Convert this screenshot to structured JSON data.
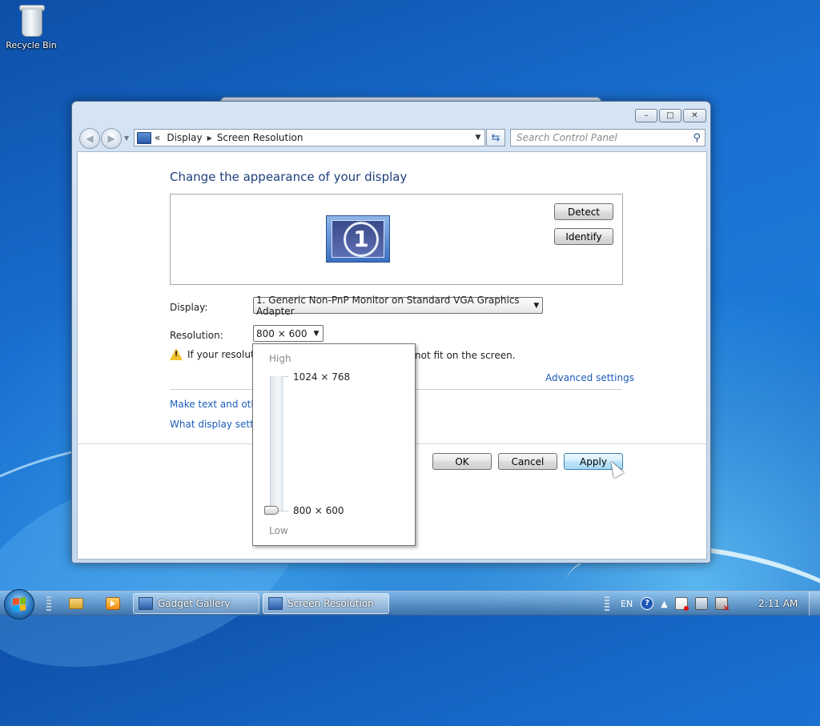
{
  "desktop": {
    "recycle_bin_label": "Recycle Bin"
  },
  "window": {
    "title_controls": {
      "minimize": "–",
      "maximize": "□",
      "close": "✕"
    },
    "breadcrumb": {
      "prefix": "«",
      "items": [
        "Display",
        "Screen Resolution"
      ],
      "separator": "▶"
    },
    "search_placeholder": "Search Control Panel",
    "page_title": "Change the appearance of your display",
    "monitor_number": "1",
    "buttons": {
      "detect": "Detect",
      "identify": "Identify",
      "ok": "OK",
      "cancel": "Cancel",
      "apply": "Apply"
    },
    "display_label": "Display:",
    "display_value": "1. Generic Non-PnP Monitor on Standard VGA Graphics Adapter",
    "resolution_label": "Resolution:",
    "resolution_value": "800 × 600",
    "warning_text_left": "If your resolutio",
    "warning_text_right": "not fit on the screen.",
    "advanced_settings": "Advanced settings",
    "link_make_text": "Make text and other",
    "link_what_display": "What display setting"
  },
  "resolution_popup": {
    "high_label": "High",
    "low_label": "Low",
    "max_resolution": "1024 × 768",
    "min_resolution": "800 × 600",
    "slider_level": 0
  },
  "taskbar": {
    "tasks": [
      "Gadget Gallery",
      "Screen Resolution"
    ],
    "language": "EN",
    "clock": "2:11 AM",
    "help_glyph": "?"
  },
  "colors": {
    "link": "#1b5bb8",
    "title": "#1e3f7a",
    "desktop": "#1a6fd0",
    "apply_border": "#3c7fb1"
  }
}
